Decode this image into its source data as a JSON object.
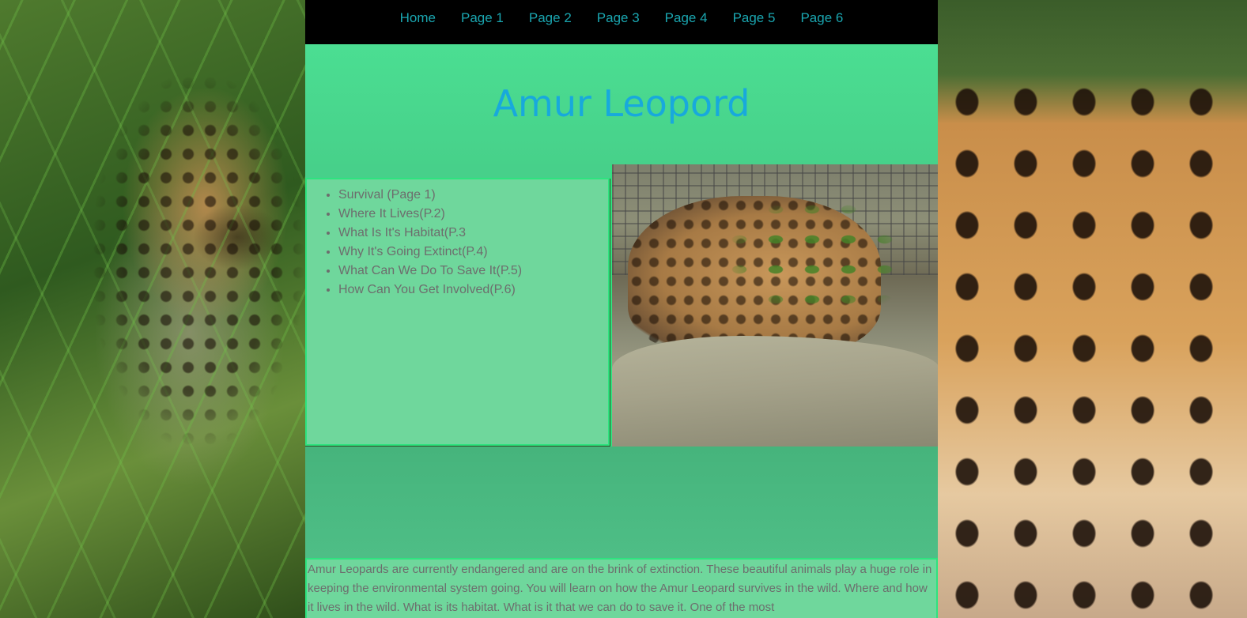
{
  "nav": {
    "items": [
      "Home",
      "Page 1",
      "Page 2",
      "Page 3",
      "Page 4",
      "Page 5",
      "Page 6"
    ]
  },
  "header": {
    "title": "Amur Leopord"
  },
  "toc": {
    "items": [
      "Survival (Page 1)",
      "Where It Lives(P.2)",
      "What Is It's Habitat(P.3",
      "Why It's Going Extinct(P.4)",
      "What Can We Do To Save It(P.5)",
      "How Can You Get Involved(P.6)"
    ]
  },
  "intro": {
    "text": "Amur Leopards are currently endangered and are on the brink of extinction. These beautiful animals play a huge role in keeping the environmental system going. You will learn on how the Amur Leopard survives in the wild. Where and how it lives in the wild. What is its habitat. What is it that we can do to save it. One of the most"
  },
  "colors": {
    "nav_bg": "#000000",
    "nav_link": "#1aa6b0",
    "header_bg": "#4bde92",
    "title": "#18a9dc",
    "panel_bg": "#6fd79c",
    "panel_border": "#2ee37f",
    "band_bg": "#46b47c",
    "body_text": "#6d6d6d"
  }
}
